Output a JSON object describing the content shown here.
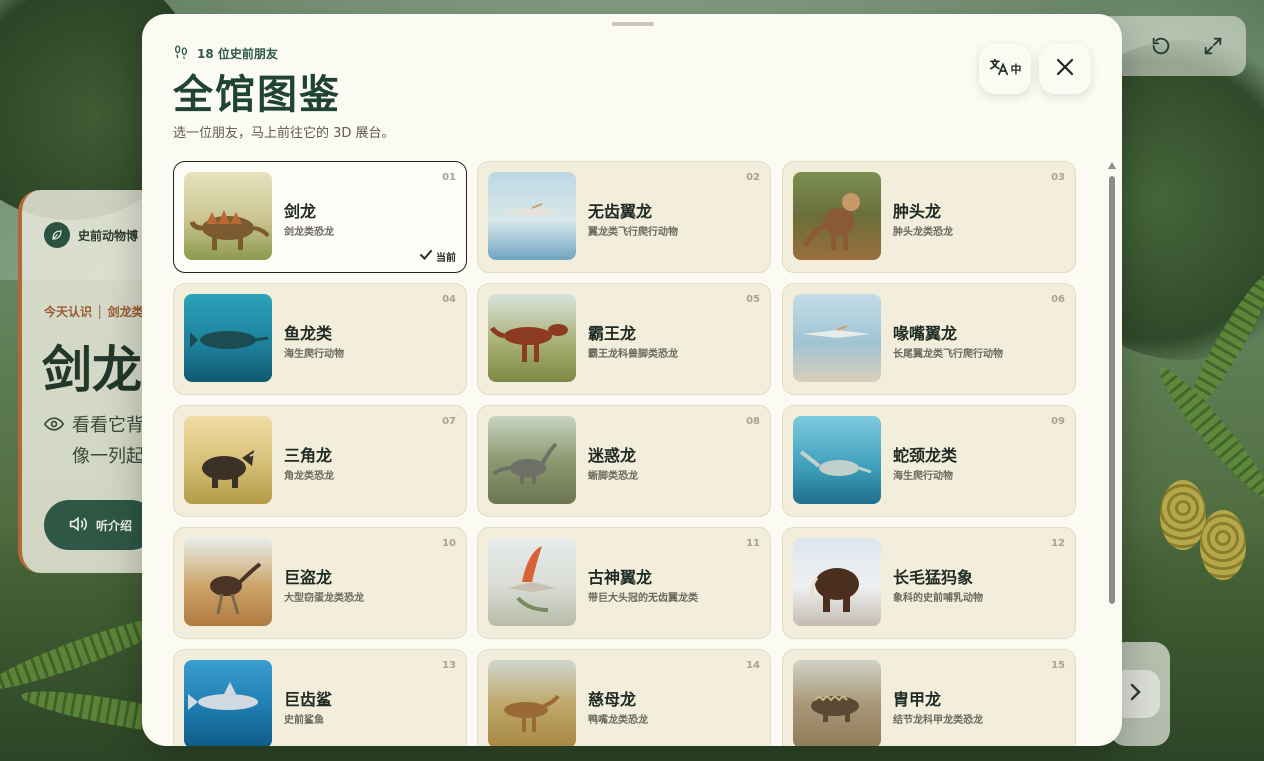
{
  "background": {
    "museum_label": "史前动物博",
    "today_label": "今天认识 │ 剑龙类",
    "current_name": "剑龙",
    "desc_line1": "看看它背",
    "desc_line2": "像一列起",
    "listen_label": "听介绍"
  },
  "toolbar": {
    "reset_icon": "reset-icon",
    "fullscreen_icon": "fullscreen-icon"
  },
  "modal": {
    "count_label": "18 位史前朋友",
    "title": "全馆图鉴",
    "subtitle": "选一位朋友，马上前往它的 3D 展台。",
    "lang_label": "中",
    "current_badge": "当前"
  },
  "animals": [
    {
      "num": "01",
      "name": "剑龙",
      "type": "剑龙类恐龙",
      "selected": true
    },
    {
      "num": "02",
      "name": "无齿翼龙",
      "type": "翼龙类飞行爬行动物",
      "selected": false
    },
    {
      "num": "03",
      "name": "肿头龙",
      "type": "肿头龙类恐龙",
      "selected": false
    },
    {
      "num": "04",
      "name": "鱼龙类",
      "type": "海生爬行动物",
      "selected": false
    },
    {
      "num": "05",
      "name": "霸王龙",
      "type": "霸王龙科兽脚类恐龙",
      "selected": false
    },
    {
      "num": "06",
      "name": "喙嘴翼龙",
      "type": "长尾翼龙类飞行爬行动物",
      "selected": false
    },
    {
      "num": "07",
      "name": "三角龙",
      "type": "角龙类恐龙",
      "selected": false
    },
    {
      "num": "08",
      "name": "迷惑龙",
      "type": "蜥脚类恐龙",
      "selected": false
    },
    {
      "num": "09",
      "name": "蛇颈龙类",
      "type": "海生爬行动物",
      "selected": false
    },
    {
      "num": "10",
      "name": "巨盗龙",
      "type": "大型窃蛋龙类恐龙",
      "selected": false
    },
    {
      "num": "11",
      "name": "古神翼龙",
      "type": "带巨大头冠的无齿翼龙类",
      "selected": false
    },
    {
      "num": "12",
      "name": "长毛猛犸象",
      "type": "象科的史前哺乳动物",
      "selected": false
    },
    {
      "num": "13",
      "name": "巨齿鲨",
      "type": "史前鲨鱼",
      "selected": false
    },
    {
      "num": "14",
      "name": "慈母龙",
      "type": "鸭嘴龙类恐龙",
      "selected": false
    },
    {
      "num": "15",
      "name": "胄甲龙",
      "type": "结节龙科甲龙类恐龙",
      "selected": false
    }
  ]
}
